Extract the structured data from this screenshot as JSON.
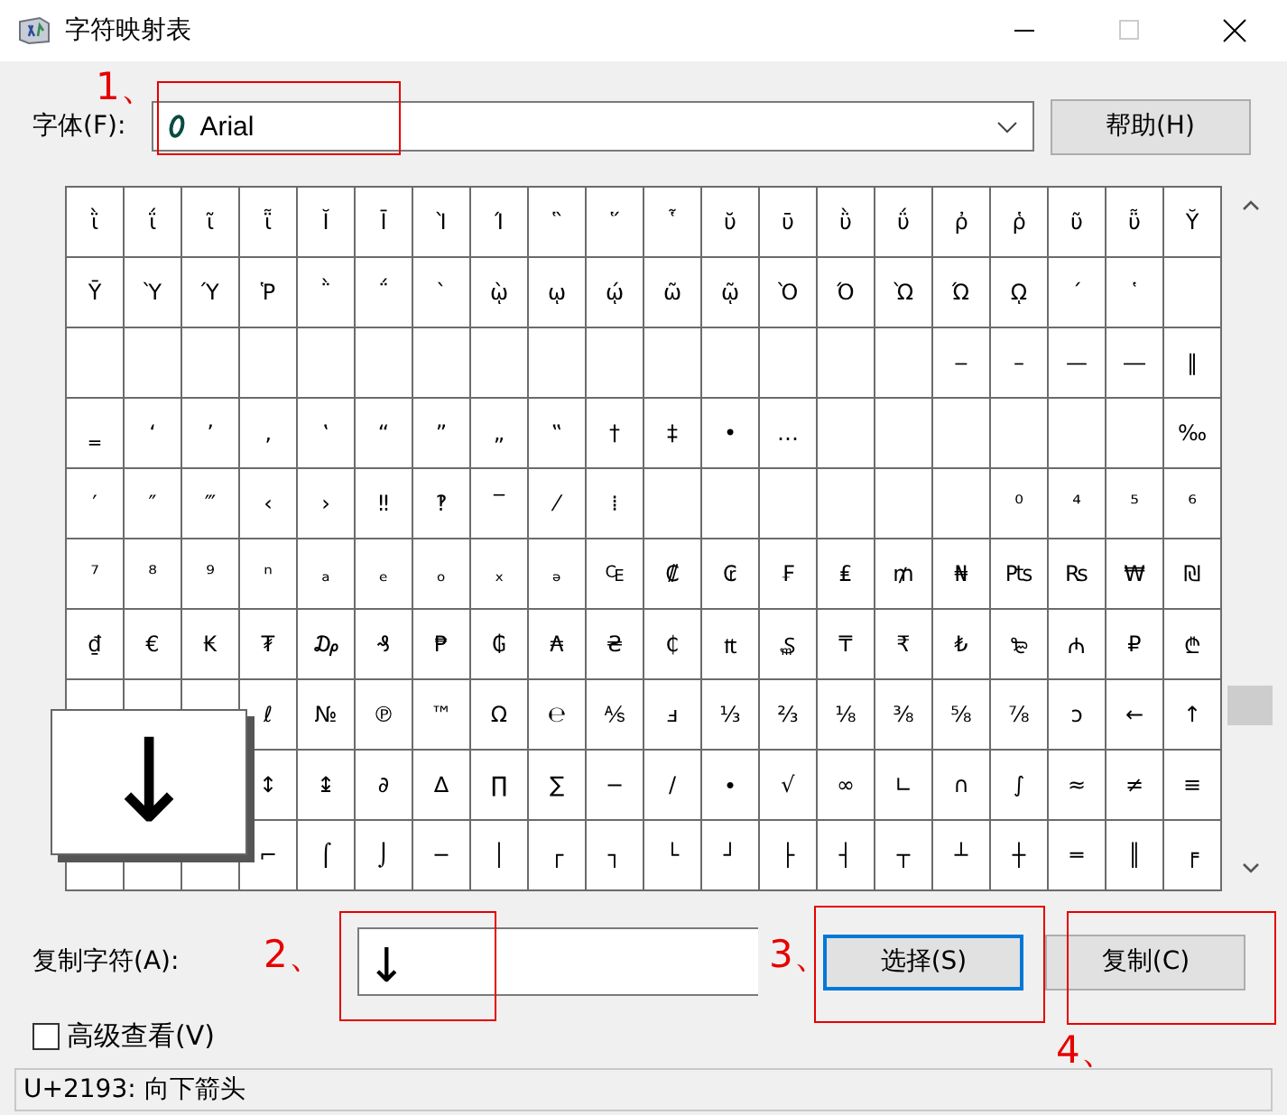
{
  "window": {
    "title": "字符映射表"
  },
  "font": {
    "label": "字体(F):",
    "value": "Arial",
    "help_button": "帮助(H)"
  },
  "grid": {
    "rows": [
      [
        "ῒ",
        "ΐ",
        "ῖ",
        "ῗ",
        "Ῐ",
        "Ῑ",
        "Ὶ",
        "Ί",
        "῝",
        "῞",
        "῟",
        "ῠ",
        "ῡ",
        "ῢ",
        "ΰ",
        "ῤ",
        "ῥ",
        "ῦ",
        "ῧ",
        "Ῠ"
      ],
      [
        "Ῡ",
        "Ὺ",
        "Ύ",
        "Ῥ",
        "῭",
        "΅",
        "`",
        "ῲ",
        "ῳ",
        "ῴ",
        "ῶ",
        "ῷ",
        "Ὸ",
        "Ό",
        "Ὼ",
        "Ώ",
        "ῼ",
        "´",
        "῾",
        null
      ],
      [
        null,
        null,
        null,
        null,
        null,
        null,
        null,
        null,
        null,
        null,
        null,
        null,
        null,
        null,
        null,
        "‒",
        "–",
        "—",
        "―",
        "‖"
      ],
      [
        "‗",
        "‘",
        "’",
        "‚",
        "‛",
        "“",
        "”",
        "„",
        "‟",
        "†",
        "‡",
        "•",
        "…",
        null,
        null,
        null,
        null,
        null,
        null,
        "‰"
      ],
      [
        "′",
        "″",
        "‴",
        "‹",
        "›",
        "‼",
        "‽",
        "‾",
        "⁄",
        "⁞",
        null,
        null,
        null,
        null,
        null,
        null,
        "⁰",
        "⁴",
        "⁵",
        "⁶"
      ],
      [
        "⁷",
        "⁸",
        "⁹",
        "ⁿ",
        "ₐ",
        "ₑ",
        "ₒ",
        "ₓ",
        "ₔ",
        "₠",
        "₡",
        "₢",
        "₣",
        "₤",
        "₥",
        "₦",
        "₧",
        "₨",
        "₩",
        "₪"
      ],
      [
        "₫",
        "€",
        "₭",
        "₮",
        "₯",
        "₰",
        "₱",
        "₲",
        "₳",
        "₴",
        "₵",
        "₶",
        "₷",
        "₸",
        "₹",
        "₺",
        "₻",
        "₼",
        "₽",
        "₾"
      ],
      [
        null,
        null,
        null,
        "ℓ",
        "№",
        "℗",
        "™",
        "Ω",
        "℮",
        "⅍",
        "ⅎ",
        "⅓",
        "⅔",
        "⅛",
        "⅜",
        "⅝",
        "⅞",
        "ↄ",
        "←",
        "↑"
      ],
      [
        null,
        null,
        null,
        "↕",
        "↨",
        "∂",
        "∆",
        "∏",
        "∑",
        "−",
        "∕",
        "∙",
        "√",
        "∞",
        "∟",
        "∩",
        "∫",
        "≈",
        "≠",
        "≡"
      ],
      [
        null,
        null,
        null,
        "⌐",
        "⌠",
        "⌡",
        "─",
        "│",
        "┌",
        "┐",
        "└",
        "┘",
        "├",
        "┤",
        "┬",
        "┴",
        "┼",
        "═",
        "║",
        "╒"
      ]
    ]
  },
  "magnifier": {
    "glyph": "↓"
  },
  "copy": {
    "label": "复制字符(A):",
    "value": "↓",
    "select_button": "选择(S)",
    "copy_button": "复制(C)"
  },
  "advanced_view": {
    "label": "高级查看(V)",
    "checked": false
  },
  "status_bar": "U+2193: 向下箭头",
  "annotations": [
    {
      "label": "1、"
    },
    {
      "label": "2、"
    },
    {
      "label": "3、"
    },
    {
      "label": "4、"
    }
  ]
}
